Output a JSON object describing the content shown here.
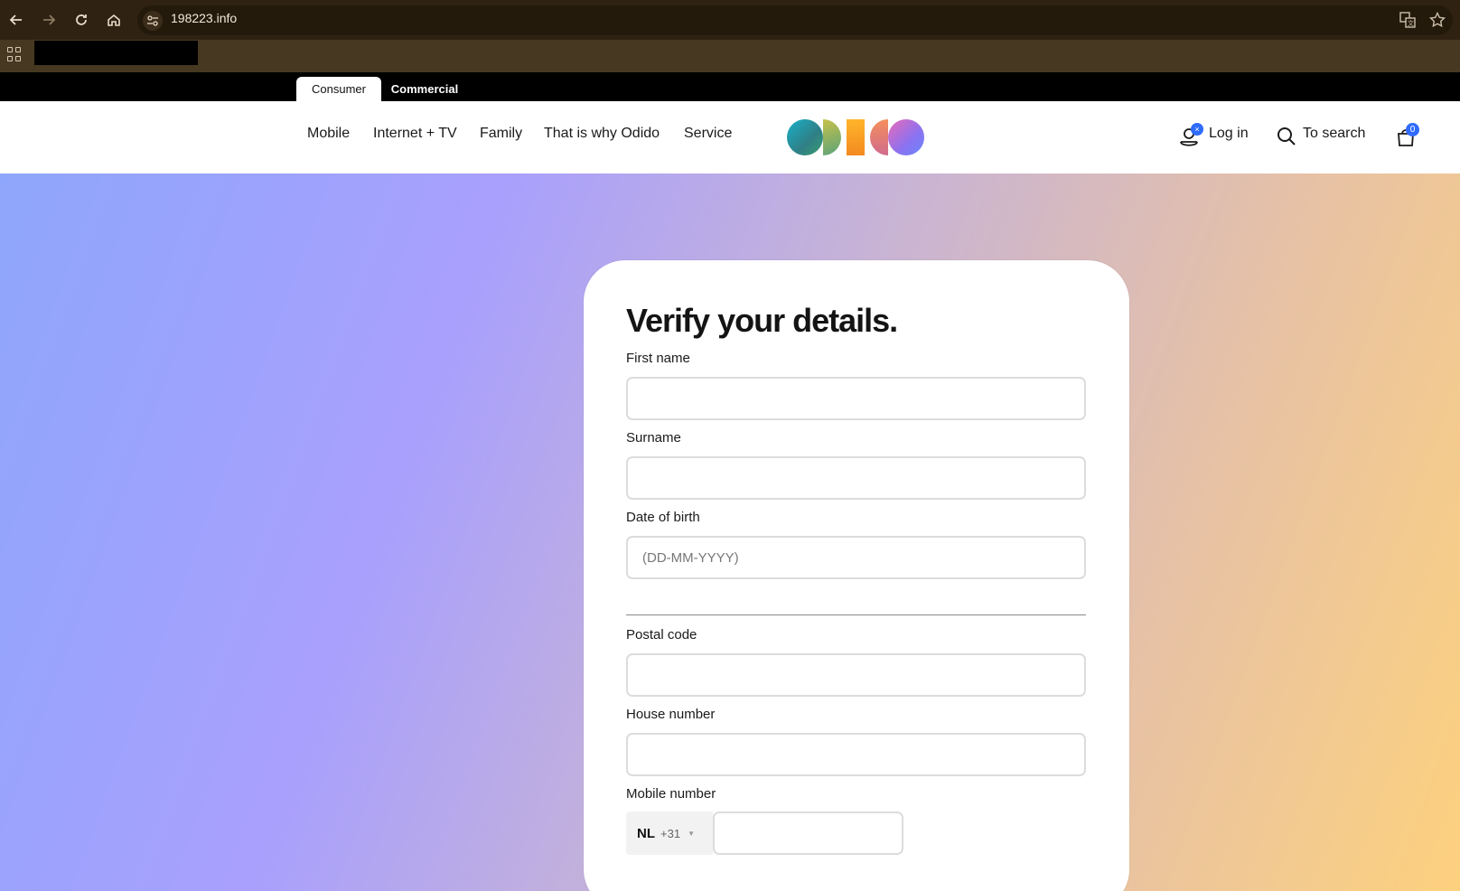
{
  "browser": {
    "url": "198223.info"
  },
  "segments": {
    "consumer": "Consumer",
    "commercial": "Commercial",
    "active": "consumer"
  },
  "nav": {
    "items": [
      "Mobile",
      "Internet + TV",
      "Family",
      "That is why Odido",
      "Service"
    ]
  },
  "header": {
    "login_label": "Log in",
    "login_badge": "×",
    "search_label": "To search",
    "cart_count": "0"
  },
  "form": {
    "title": "Verify your details.",
    "first_name_label": "First name",
    "surname_label": "Surname",
    "dob_label": "Date of birth",
    "dob_placeholder": "(DD-MM-YYYY)",
    "postal_label": "Postal code",
    "house_label": "House number",
    "mobile_label": "Mobile number",
    "country_code": "NL",
    "dial_code": "+31"
  },
  "colors": {
    "chrome": "#2f2212",
    "bookmark_bar": "#473822",
    "accent_blue": "#2f6bff"
  }
}
